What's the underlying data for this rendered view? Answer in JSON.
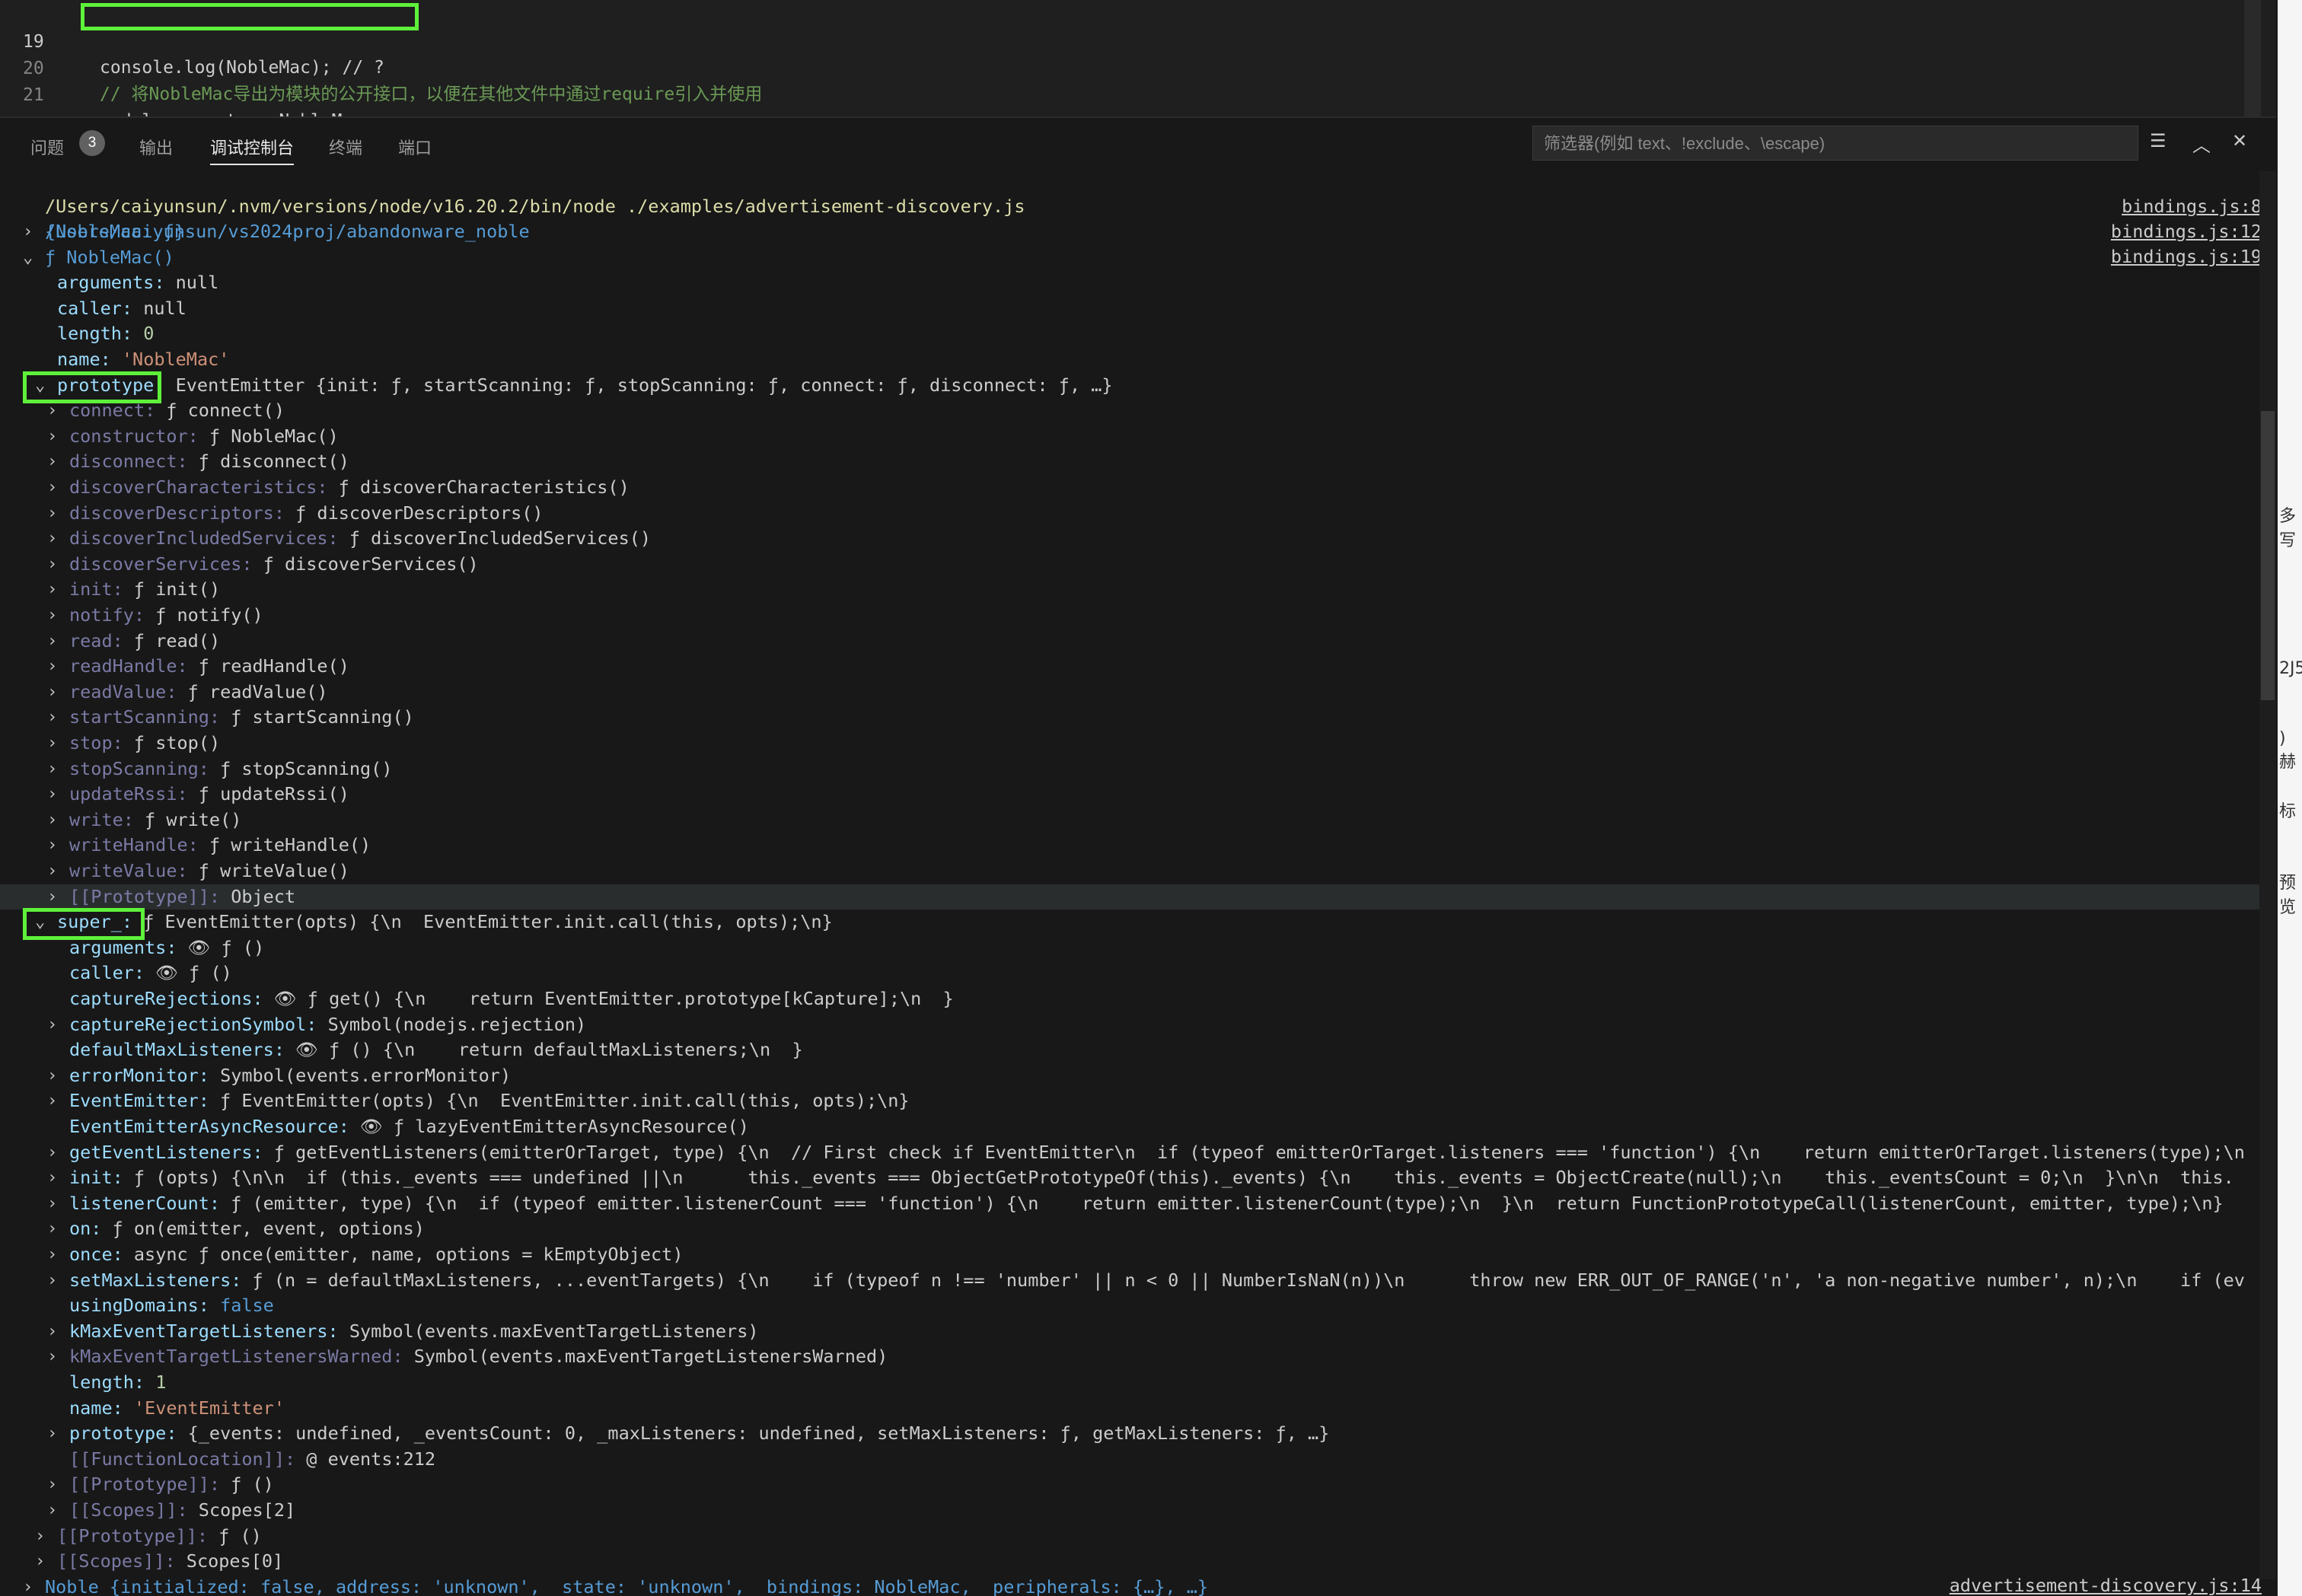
{
  "editor": {
    "lines": [
      {
        "num": "19",
        "code": "console.log(NobleMac); // ?"
      },
      {
        "num": "20",
        "comment": "// 将NobleMac导出为模块的公开接口，以便在其他文件中通过require引入并使用"
      },
      {
        "num": "21",
        "code": "module.exports = NobleMac;"
      }
    ]
  },
  "panel": {
    "tabs": [
      {
        "label": "问题",
        "badge": "3"
      },
      {
        "label": "输出"
      },
      {
        "label": "调试控制台"
      },
      {
        "label": "终端"
      },
      {
        "label": "端口"
      }
    ],
    "active_tab": "调试控制台",
    "filter_placeholder": "筛选器(例如 text、!exclude、\\escape)"
  },
  "console": {
    "launch_line": "/Users/caiyunsun/.nvm/versions/node/v16.20.2/bin/node ./examples/advertisement-discovery.js",
    "cwd_line": "/Users/caiyunsun/vs2024proj/abandonware_noble",
    "sources": [
      "bindings.js:8",
      "bindings.js:12",
      "bindings.js:19"
    ],
    "bottom_source": "advertisement-discovery.js:14",
    "rows": [
      {
        "key": "",
        "val": "{NobleMac: ƒ}"
      },
      {
        "key": "",
        "val": "ƒ NobleMac()"
      },
      {
        "key": "arguments:",
        "val": "null"
      },
      {
        "key": "caller:",
        "val": "null"
      },
      {
        "key": "length:",
        "val": "0"
      },
      {
        "key": "name:",
        "val": "'NobleMac'"
      },
      {
        "key": "prototype:",
        "val": "EventEmitter {init: ƒ, startScanning: ƒ, stopScanning: ƒ, connect: ƒ, disconnect: ƒ, …}"
      },
      {
        "key": "connect:",
        "val": "ƒ connect()"
      },
      {
        "key": "constructor:",
        "val": "ƒ NobleMac()"
      },
      {
        "key": "disconnect:",
        "val": "ƒ disconnect()"
      },
      {
        "key": "discoverCharacteristics:",
        "val": "ƒ discoverCharacteristics()"
      },
      {
        "key": "discoverDescriptors:",
        "val": "ƒ discoverDescriptors()"
      },
      {
        "key": "discoverIncludedServices:",
        "val": "ƒ discoverIncludedServices()"
      },
      {
        "key": "discoverServices:",
        "val": "ƒ discoverServices()"
      },
      {
        "key": "init:",
        "val": "ƒ init()"
      },
      {
        "key": "notify:",
        "val": "ƒ notify()"
      },
      {
        "key": "read:",
        "val": "ƒ read()"
      },
      {
        "key": "readHandle:",
        "val": "ƒ readHandle()"
      },
      {
        "key": "readValue:",
        "val": "ƒ readValue()"
      },
      {
        "key": "startScanning:",
        "val": "ƒ startScanning()"
      },
      {
        "key": "stop:",
        "val": "ƒ stop()"
      },
      {
        "key": "stopScanning:",
        "val": "ƒ stopScanning()"
      },
      {
        "key": "updateRssi:",
        "val": "ƒ updateRssi()"
      },
      {
        "key": "write:",
        "val": "ƒ write()"
      },
      {
        "key": "writeHandle:",
        "val": "ƒ writeHandle()"
      },
      {
        "key": "writeValue:",
        "val": "ƒ writeValue()"
      },
      {
        "key": "[[Prototype]]:",
        "val": "Object"
      },
      {
        "key": "super_:",
        "val": "ƒ EventEmitter(opts) {\\n  EventEmitter.init.call(this, opts);\\n}"
      },
      {
        "key": "arguments:",
        "val": "👁 ƒ ()"
      },
      {
        "key": "caller:",
        "val": "👁 ƒ ()"
      },
      {
        "key": "captureRejections:",
        "val": "👁 ƒ get() {\\n    return EventEmitter.prototype[kCapture];\\n  }"
      },
      {
        "key": "captureRejectionSymbol:",
        "val": "Symbol(nodejs.rejection)"
      },
      {
        "key": "defaultMaxListeners:",
        "val": "👁 ƒ () {\\n    return defaultMaxListeners;\\n  }"
      },
      {
        "key": "errorMonitor:",
        "val": "Symbol(events.errorMonitor)"
      },
      {
        "key": "EventEmitter:",
        "val": "ƒ EventEmitter(opts) {\\n  EventEmitter.init.call(this, opts);\\n}"
      },
      {
        "key": "EventEmitterAsyncResource:",
        "val": "👁 ƒ lazyEventEmitterAsyncResource()"
      },
      {
        "key": "getEventListeners:",
        "val": "ƒ getEventListeners(emitterOrTarget, type) {\\n  // First check if EventEmitter\\n  if (typeof emitterOrTarget.listeners === 'function') {\\n    return emitterOrTarget.listeners(type);\\n"
      },
      {
        "key": "init:",
        "val": "ƒ (opts) {\\n\\n  if (this._events === undefined ||\\n      this._events === ObjectGetPrototypeOf(this)._events) {\\n    this._events = ObjectCreate(null);\\n    this._eventsCount = 0;\\n  }\\n\\n  this."
      },
      {
        "key": "listenerCount:",
        "val": "ƒ (emitter, type) {\\n  if (typeof emitter.listenerCount === 'function') {\\n    return emitter.listenerCount(type);\\n  }\\n  return FunctionPrototypeCall(listenerCount, emitter, type);\\n}"
      },
      {
        "key": "on:",
        "val": "ƒ on(emitter, event, options)"
      },
      {
        "key": "once:",
        "val": "async ƒ once(emitter, name, options = kEmptyObject)"
      },
      {
        "key": "setMaxListeners:",
        "val": "ƒ (n = defaultMaxListeners, ...eventTargets) {\\n    if (typeof n !== 'number' || n < 0 || NumberIsNaN(n))\\n      throw new ERR_OUT_OF_RANGE('n', 'a non-negative number', n);\\n    if (ev"
      },
      {
        "key": "usingDomains:",
        "val": "false"
      },
      {
        "key": "kMaxEventTargetListeners:",
        "val": "Symbol(events.maxEventTargetListeners)"
      },
      {
        "key": "kMaxEventTargetListenersWarned:",
        "val": "Symbol(events.maxEventTargetListenersWarned)"
      },
      {
        "key": "length:",
        "val": "1"
      },
      {
        "key": "name:",
        "val": "'EventEmitter'"
      },
      {
        "key": "prototype:",
        "val": "{_events: undefined, _eventsCount: 0, _maxListeners: undefined, setMaxListeners: ƒ, getMaxListeners: ƒ, …}"
      },
      {
        "key": "[[FunctionLocation]]:",
        "val": "@ events:212"
      },
      {
        "key": "[[Prototype]]:",
        "val": "ƒ ()"
      },
      {
        "key": "[[Scopes]]:",
        "val": "Scopes[2]"
      },
      {
        "key": "[[Prototype]]:",
        "val": "ƒ ()"
      },
      {
        "key": "[[Scopes]]:",
        "val": "Scopes[0]"
      },
      {
        "key": "",
        "val": "Noble {initialized: false, address: 'unknown', _state: 'unknown', _bindings: NobleMac, _peripherals: {…}, …}"
      }
    ]
  },
  "right_strip_chars": [
    "多写",
    "2J5",
    ") 赫",
    "标",
    "预览"
  ]
}
